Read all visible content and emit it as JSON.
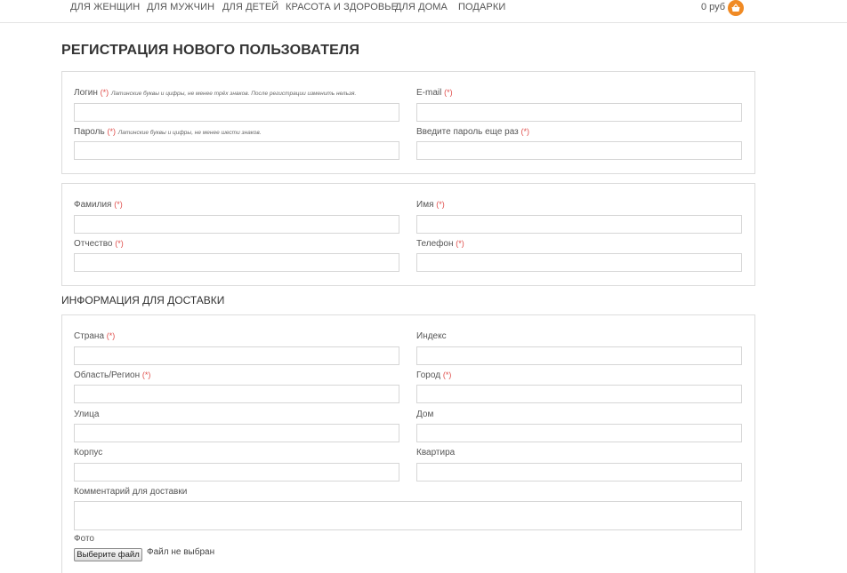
{
  "nav": {
    "items": [
      "ДЛЯ ЖЕНЩИН",
      "ДЛЯ МУЖЧИН",
      "ДЛЯ ДЕТЕЙ",
      "КРАСОТА И ЗДОРОВЬЕ",
      "ДЛЯ ДОМА",
      "ПОДАРКИ"
    ],
    "cart_total": "0 руб",
    "cart_icon": "basket-icon",
    "accent_color": "#f08a24"
  },
  "page_title": "РЕГИСТРАЦИЯ НОВОГО ПОЛЬЗОВАТЕЛЯ",
  "required_mark": "(*)",
  "account": {
    "login_label": "Логин",
    "login_hint": "Латинские буквы и цифры, не менее трёх знаков. После регистрации изменить нельзя.",
    "email_label": "E-mail",
    "password_label": "Пароль",
    "password_hint": "Латинские буквы и цифры, не менее шести знаков.",
    "password_repeat_label": "Введите пароль еще раз"
  },
  "personal": {
    "lastname_label": "Фамилия",
    "firstname_label": "Имя",
    "middlename_label": "Отчество",
    "phone_label": "Телефон"
  },
  "delivery": {
    "section_title": "ИНФОРМАЦИЯ ДЛЯ ДОСТАВКИ",
    "country_label": "Страна",
    "zip_label": "Индекс",
    "region_label": "Область/Регион",
    "city_label": "Город",
    "street_label": "Улица",
    "house_label": "Дом",
    "building_label": "Корпус",
    "apartment_label": "Квартира",
    "comment_label": "Комментарий для доставки",
    "photo_label": "Фото",
    "file_button": "Выберите файл",
    "file_status": "Файл не выбран"
  }
}
